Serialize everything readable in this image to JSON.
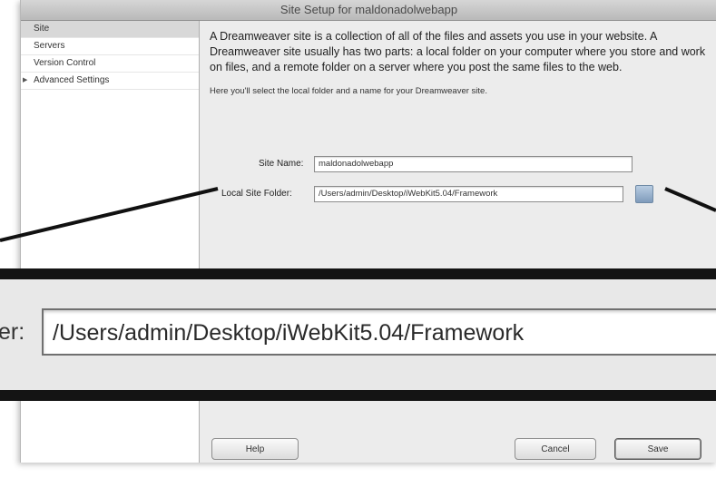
{
  "dialog": {
    "title": "Site Setup for maldonadolwebapp"
  },
  "sidebar": {
    "items": [
      {
        "label": "Site",
        "selected": true
      },
      {
        "label": "Servers"
      },
      {
        "label": "Version Control"
      },
      {
        "label": "Advanced Settings",
        "expandable": true
      }
    ]
  },
  "content": {
    "intro": "A Dreamweaver site is a collection of all of the files and assets you use in your website. A Dreamweaver site usually has two parts: a local folder on your computer where you store and work on files, and a remote folder on a server where you post the same files to the web.",
    "hint": "Here you'll select the local folder and a name for your Dreamweaver site.",
    "site_name_label": "Site Name:",
    "site_name_value": "maldonadolwebapp",
    "local_folder_label": "Local Site Folder:",
    "local_folder_value": "/Users/admin/Desktop/iWebKit5.04/Framework"
  },
  "buttons": {
    "help": "Help",
    "cancel": "Cancel",
    "save": "Save"
  },
  "zoom": {
    "label_fragment": "er:",
    "field_value": "/Users/admin/Desktop/iWebKit5.04/Framework"
  },
  "icons": {
    "folder_button": "folder-icon",
    "expand": "disclosure-triangle-icon"
  }
}
